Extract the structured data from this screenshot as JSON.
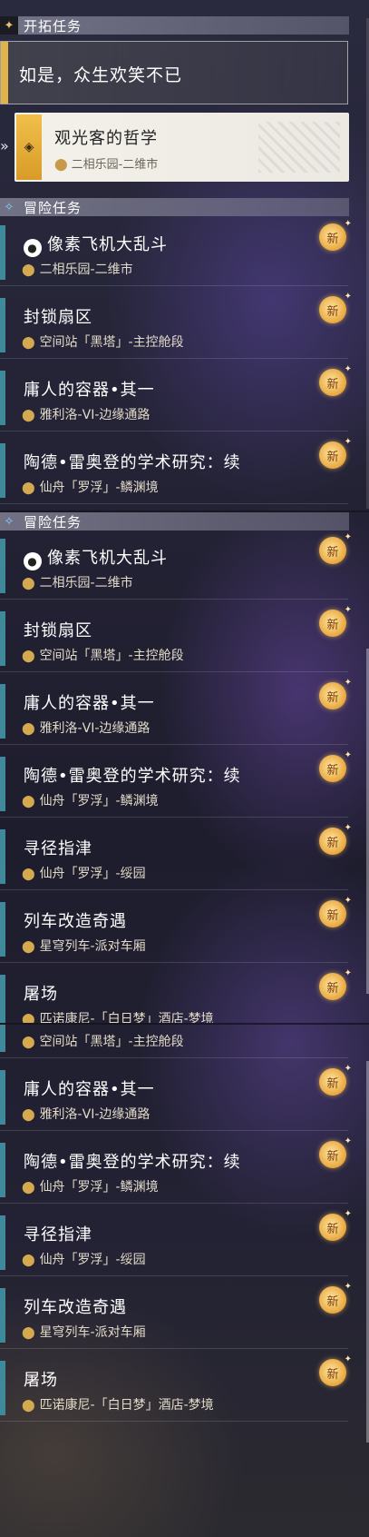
{
  "trailblaze_header": {
    "label": "开拓任务",
    "icon": "diamond-star-icon"
  },
  "trailblaze_quest": {
    "title": "如是，众生欢笑不已"
  },
  "selected_quest": {
    "title": "观光客的哲学",
    "location": "二相乐园-二维市"
  },
  "adventure_header": {
    "label": "冒险任务",
    "icon": "sparkle-icon"
  },
  "new_badge": "新",
  "quests": [
    {
      "title": "像素飞机大乱斗",
      "location": "二相乐园-二维市",
      "has_pixel_icon": true
    },
    {
      "title": "封锁扇区",
      "location": "空间站「黑塔」-主控舱段"
    },
    {
      "title": "庸人的容器•其一",
      "location": "雅利洛-VI-边缘通路"
    },
    {
      "title": "陶德•雷奥登的学术研究：续",
      "location": "仙舟「罗浮」-鳞渊境"
    },
    {
      "title": "寻径指津",
      "location": "仙舟「罗浮」-绥园"
    },
    {
      "title": "列车改造奇遇",
      "location": "星穹列车-派对车厢"
    },
    {
      "title": "屠场",
      "location": "匹诺康尼-「白日梦」酒店-梦境"
    }
  ]
}
